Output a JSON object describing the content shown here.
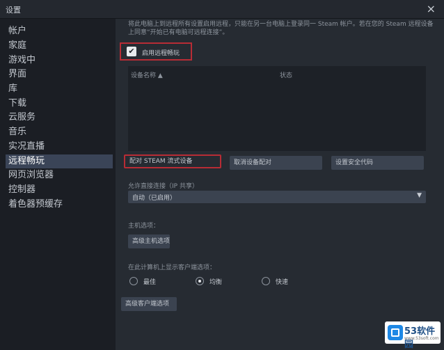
{
  "window": {
    "title": "设置",
    "close_glyph": "×"
  },
  "sidebar": {
    "items": [
      {
        "label": "帐户"
      },
      {
        "label": "家庭"
      },
      {
        "label": "游戏中"
      },
      {
        "label": "界面"
      },
      {
        "label": "库"
      },
      {
        "label": "下载"
      },
      {
        "label": "云服务"
      },
      {
        "label": "音乐"
      },
      {
        "label": "实况直播"
      },
      {
        "label": "远程畅玩"
      },
      {
        "label": "网页浏览器"
      },
      {
        "label": "控制器"
      },
      {
        "label": "着色器预缓存"
      }
    ],
    "active_index": 9
  },
  "main": {
    "description": "将此电脑上到远程所有设置启用远程，只能在另一台电脑上登录同一 Steam 帐户。若在您的 Steam 远程设备上同意“开始已有电脑可远程连接”。",
    "enable_label": "启用远程畅玩",
    "enable_checked": true,
    "device_table": {
      "col_name": "设备名称 ▲",
      "col_status": "状态"
    },
    "buttons": {
      "pair": "配对 STEAM 流式设备",
      "unpair": "取消设备配对",
      "security": "设置安全代码"
    },
    "bandwidth_label": "允许直接连接（IP 共享）",
    "bandwidth_value": "自动（已启用）",
    "host_label": "主机选项：",
    "host_button": "高级主机选项",
    "client_label": "在此计算机上显示客户端选项：",
    "radio": [
      {
        "label": "最佳",
        "on": false
      },
      {
        "label": "均衡",
        "on": true
      },
      {
        "label": "快速",
        "on": false
      }
    ],
    "advanced_client_button": "高级客户端选项"
  },
  "watermark": {
    "text": "53软件园",
    "sub": "www.53soft.com"
  }
}
